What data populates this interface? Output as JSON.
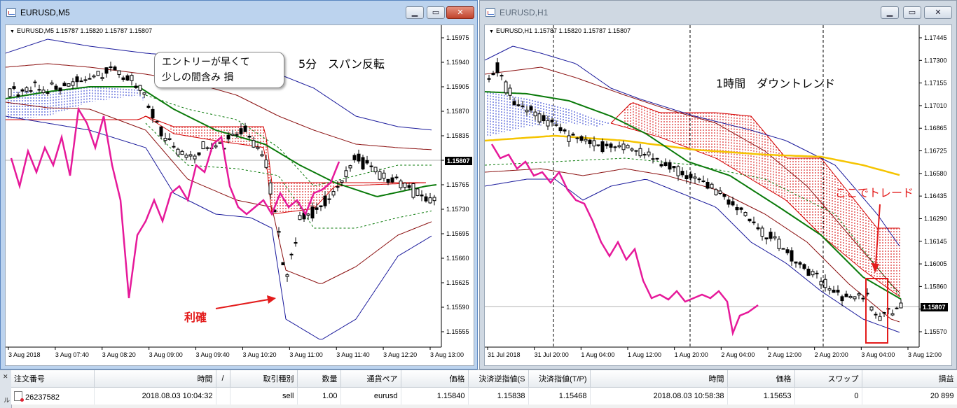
{
  "left_window": {
    "title": "EURUSD,M5",
    "ohlc": "EURUSD,M5  1.15787 1.15820 1.15787 1.15807",
    "price_labels": [
      "1.15975",
      "1.15940",
      "1.15905",
      "1.15870",
      "1.15835",
      "1.15800",
      "1.15765",
      "1.15730",
      "1.15695",
      "1.15660",
      "1.15625",
      "1.15590",
      "1.15555"
    ],
    "current_price": "1.15807",
    "time_labels": [
      "3 Aug 2018",
      "3 Aug 07:40",
      "3 Aug 08:20",
      "3 Aug 09:00",
      "3 Aug 09:40",
      "3 Aug 10:20",
      "3 Aug 11:00",
      "3 Aug 11:40",
      "3 Aug 12:20",
      "3 Aug 13:00"
    ],
    "annotation_title": "5分　スパン反転",
    "bubble_line1": "エントリーが早くて",
    "bubble_line2": "少しの間含み 損",
    "profit_label": "利確"
  },
  "right_window": {
    "title": "EURUSD,H1",
    "ohlc": "EURUSD,H1  1.15787 1.15820 1.15787 1.15807",
    "price_labels": [
      "1.17445",
      "1.17300",
      "1.17155",
      "1.17010",
      "1.16865",
      "1.16725",
      "1.16580",
      "1.16435",
      "1.16290",
      "1.16145",
      "1.16005",
      "1.15860",
      "1.15715",
      "1.15570"
    ],
    "current_price": "1.15807",
    "time_labels": [
      "31 Jul 2018",
      "31 Jul 20:00",
      "1 Aug 04:00",
      "1 Aug 12:00",
      "1 Aug 20:00",
      "2 Aug 04:00",
      "2 Aug 12:00",
      "2 Aug 20:00",
      "3 Aug 04:00",
      "3 Aug 12:00"
    ],
    "annotation_title": "1時間　ダウントレンド",
    "trade_label": "ここでトレード"
  },
  "colors": {
    "bollinger": "#1b1b9c",
    "bollinger_inner": "#8b1010",
    "ma_green": "#0a7a0a",
    "ma_yellow": "#f5c400",
    "rsi_magenta": "#e6199a",
    "kumo_red": "#d40000",
    "kumo_blue": "#2233cc",
    "annotation_red": "#e31b1b"
  },
  "orders": {
    "headers": [
      "注文番号",
      "時間",
      "/",
      "取引種別",
      "数量",
      "通貨ペア",
      "価格",
      "決済逆指値(S",
      "決済指値(T/P)",
      "時間",
      "価格",
      "スワップ",
      "損益"
    ],
    "row": [
      "26237582",
      "2018.08.03 10:04:32",
      "",
      "sell",
      "1.00",
      "eurusd",
      "1.15840",
      "1.15838",
      "1.15468",
      "2018.08.03 10:58:38",
      "1.15653",
      "0",
      "20 899"
    ]
  },
  "terminal_side_label": "ターミナル"
}
